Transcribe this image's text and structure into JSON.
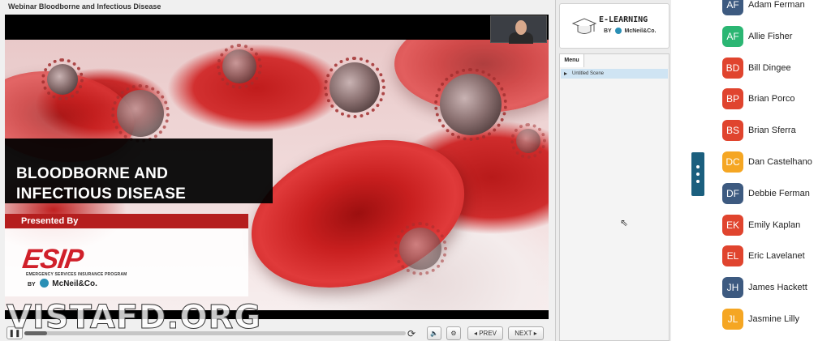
{
  "player": {
    "title": "Webinar Bloodborne and Infectious Disease",
    "slide": {
      "title_line1": "BLOODBORNE AND",
      "title_line2": "INFECTIOUS DISEASE",
      "presented_by": "Presented By",
      "esip_logo": "ESIP",
      "esip_tagline": "EMERGENCY SERVICES INSURANCE PROGRAM",
      "mcneil_by": "BY",
      "mcneil_name": "McNeil&Co."
    },
    "controls": {
      "pause_icon": "pause-icon",
      "replay_icon": "replay-icon",
      "volume_icon": "volume-icon",
      "settings_icon": "gear-icon",
      "prev_label": "◂ PREV",
      "next_label": "NEXT ▸",
      "progress": 0.06
    },
    "watermark": "VISTAFD.ORG"
  },
  "sidebar": {
    "logo_title": "E-LEARNING",
    "logo_by": "BY",
    "logo_company": "McNeil&Co.",
    "menu_tab": "Menu",
    "scenes": [
      "Untitled Scene"
    ]
  },
  "participants": [
    {
      "initials": "AF",
      "name": "Adam Ferman",
      "color": "#3d5a80"
    },
    {
      "initials": "AF",
      "name": "Allie Fisher",
      "color": "#2bb673"
    },
    {
      "initials": "BD",
      "name": "Bill Dingee",
      "color": "#e0442e"
    },
    {
      "initials": "BP",
      "name": "Brian Porco",
      "color": "#e0442e"
    },
    {
      "initials": "BS",
      "name": "Brian Sferra",
      "color": "#e0442e"
    },
    {
      "initials": "DC",
      "name": "Dan Castelhano",
      "color": "#f5a623"
    },
    {
      "initials": "DF",
      "name": "Debbie Ferman",
      "color": "#3d5a80"
    },
    {
      "initials": "EK",
      "name": "Emily Kaplan",
      "color": "#e0442e"
    },
    {
      "initials": "EL",
      "name": "Eric Lavelanet",
      "color": "#e0442e"
    },
    {
      "initials": "JH",
      "name": "James Hackett",
      "color": "#3d5a80"
    },
    {
      "initials": "JL",
      "name": "Jasmine Lilly",
      "color": "#f5a623"
    }
  ]
}
